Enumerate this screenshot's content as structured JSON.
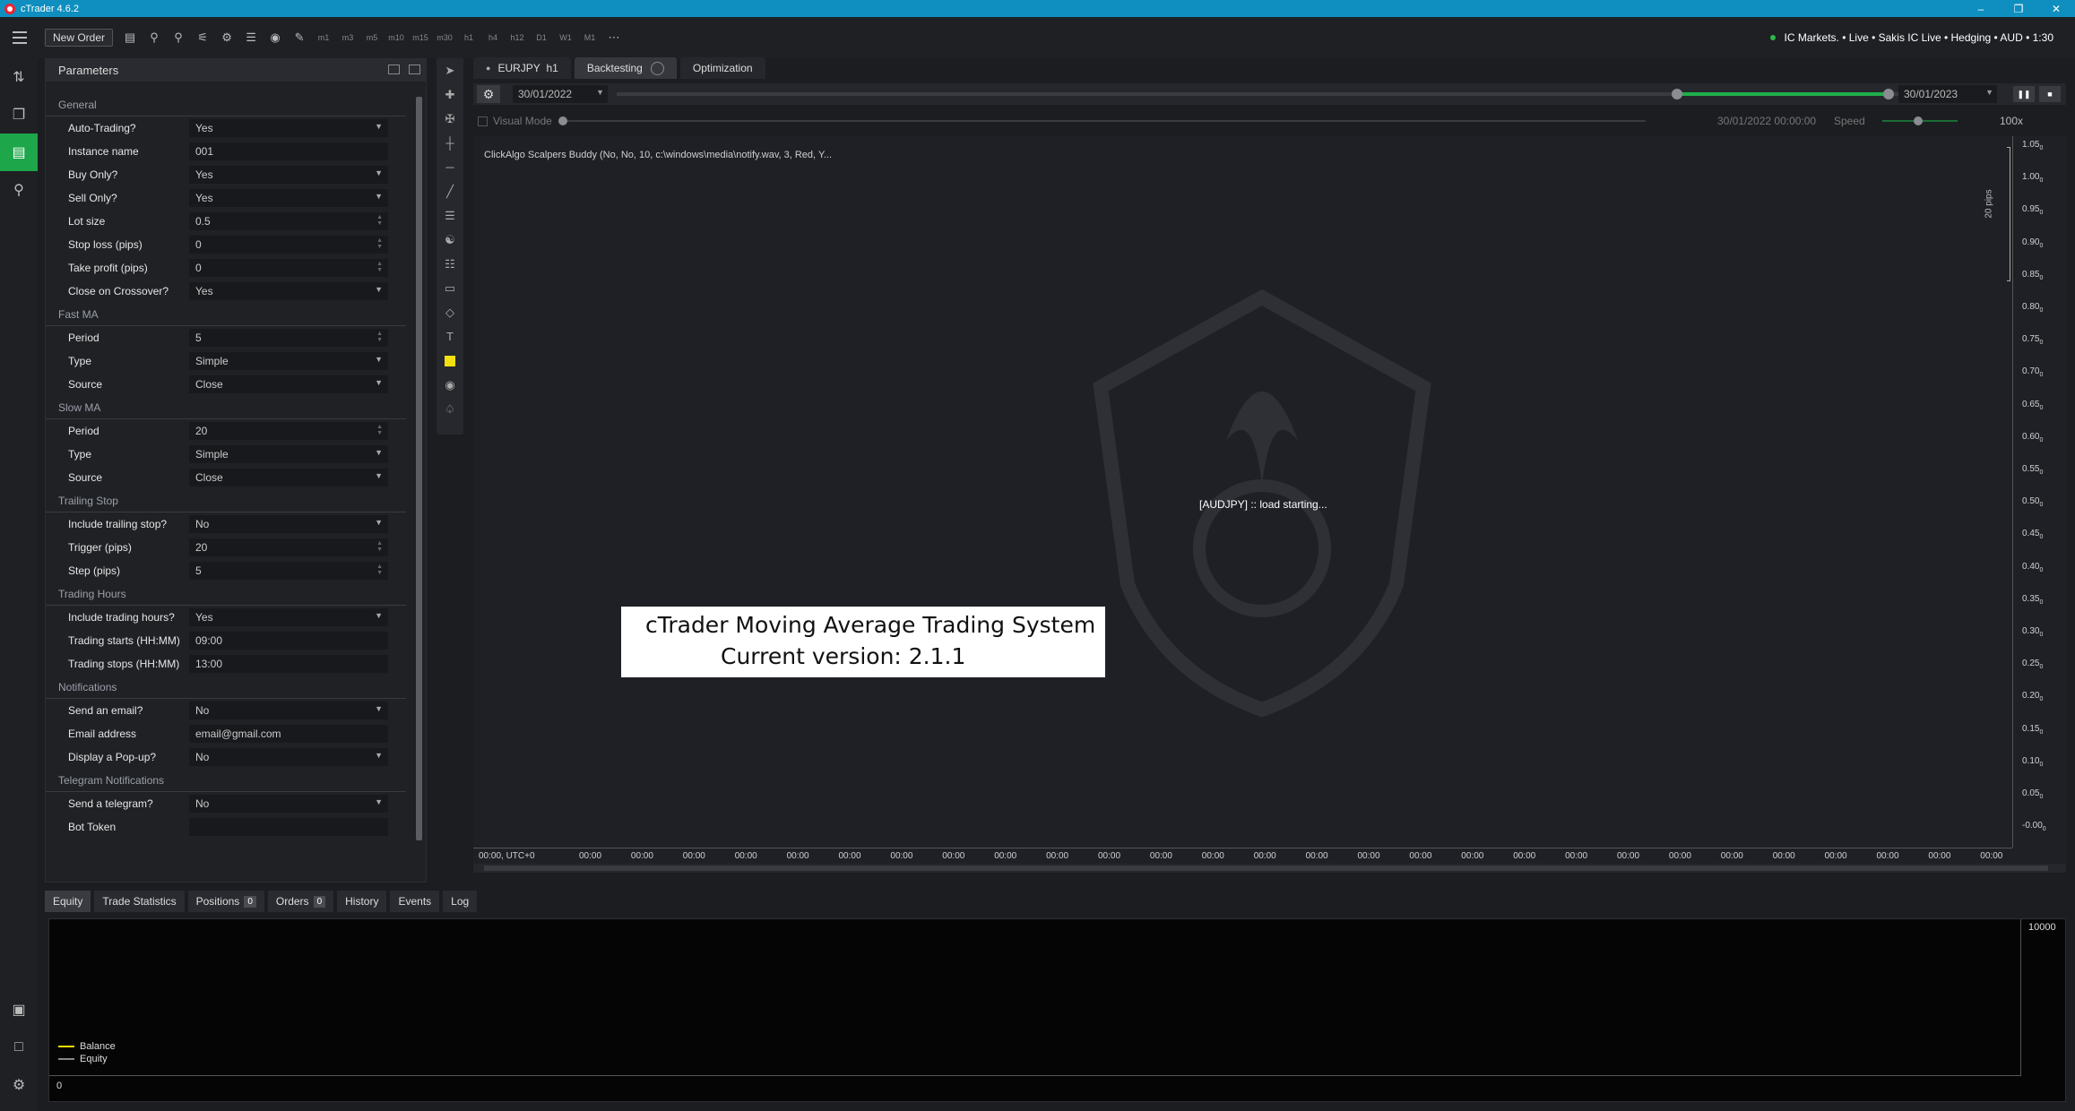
{
  "titlebar": {
    "title": "cTrader 4.6.2"
  },
  "toolbar": {
    "new_order": "New Order",
    "timeframes": [
      "m1",
      "m3",
      "m5",
      "m10",
      "m15",
      "m30",
      "h1",
      "h4",
      "h12",
      "D1",
      "W1",
      "M1"
    ],
    "account": "IC Markets. • Live • Sakis IC Live • Hedging • AUD • 1:30"
  },
  "params": {
    "title": "Parameters",
    "general": {
      "section": "General",
      "auto_trading": {
        "label": "Auto-Trading?",
        "value": "Yes"
      },
      "instance_name": {
        "label": "Instance name",
        "value": "001"
      },
      "buy_only": {
        "label": "Buy Only?",
        "value": "Yes"
      },
      "sell_only": {
        "label": "Sell Only?",
        "value": "Yes"
      },
      "lot_size": {
        "label": "Lot size",
        "value": "0.5"
      },
      "stop_loss": {
        "label": "Stop loss (pips)",
        "value": "0"
      },
      "take_profit": {
        "label": "Take profit (pips)",
        "value": "0"
      },
      "close_crossover": {
        "label": "Close on Crossover?",
        "value": "Yes"
      }
    },
    "fast_ma": {
      "section": "Fast MA",
      "period": {
        "label": "Period",
        "value": "5"
      },
      "type": {
        "label": "Type",
        "value": "Simple"
      },
      "source": {
        "label": "Source",
        "value": "Close"
      }
    },
    "slow_ma": {
      "section": "Slow MA",
      "period": {
        "label": "Period",
        "value": "20"
      },
      "type": {
        "label": "Type",
        "value": "Simple"
      },
      "source": {
        "label": "Source",
        "value": "Close"
      }
    },
    "trailing": {
      "section": "Trailing Stop",
      "include": {
        "label": "Include trailing stop?",
        "value": "No"
      },
      "trigger": {
        "label": "Trigger (pips)",
        "value": "20"
      },
      "step": {
        "label": "Step (pips)",
        "value": "5"
      }
    },
    "hours": {
      "section": "Trading Hours",
      "include": {
        "label": "Include trading hours?",
        "value": "Yes"
      },
      "starts": {
        "label": "Trading starts (HH:MM)",
        "value": "09:00"
      },
      "stops": {
        "label": "Trading stops (HH:MM)",
        "value": "13:00"
      }
    },
    "notifications": {
      "section": "Notifications",
      "email": {
        "label": "Send an email?",
        "value": "No"
      },
      "address": {
        "label": "Email address",
        "value": "email@gmail.com"
      },
      "popup": {
        "label": "Display a Pop-up?",
        "value": "No"
      }
    },
    "telegram": {
      "section": "Telegram Notifications",
      "send": {
        "label": "Send a telegram?",
        "value": "No"
      },
      "token": {
        "label": "Bot Token",
        "value": ""
      }
    }
  },
  "tabs": {
    "symbol": "EURJPY",
    "timeframe": "h1",
    "backtesting": "Backtesting",
    "optimization": "Optimization"
  },
  "backtest": {
    "start_date": "30/01/2022",
    "end_date": "30/01/2023",
    "progress_pct": 100,
    "visual_mode": "Visual Mode",
    "current_time": "30/01/2022 00:00:00",
    "speed_label": "Speed",
    "speed_value": "100x"
  },
  "chart": {
    "indicator_label": "ClickAlgo Scalpers Buddy (No, No, 10, c:\\windows\\media\\notify.wav, 3, Red, Y...",
    "status": "[AUDJPY] :: load starting...",
    "pips_label": "20 pips",
    "y_ticks": [
      "1.05",
      "1.00",
      "0.95",
      "0.90",
      "0.85",
      "0.80",
      "0.75",
      "0.70",
      "0.65",
      "0.60",
      "0.55",
      "0.50",
      "0.45",
      "0.40",
      "0.35",
      "0.30",
      "0.25",
      "0.20",
      "0.15",
      "0.10",
      "0.05",
      "-0.00"
    ],
    "y_subscript": "0",
    "x_first": "00:00, UTC+0",
    "x_tick": "00:00",
    "x_tick_count": 28
  },
  "banner": {
    "line1": "cTrader Moving Average Trading System",
    "line2": "Current version: 2.1.1"
  },
  "bottom": {
    "tabs": {
      "equity": "Equity",
      "trade_stats": "Trade Statistics",
      "positions": "Positions",
      "orders": "Orders",
      "history": "History",
      "events": "Events",
      "log": "Log"
    },
    "positions_count": "0",
    "orders_count": "0",
    "y_max": "10000",
    "y_min": "0",
    "legend_balance": "Balance",
    "legend_equity": "Equity",
    "balance_color": "#f0e000",
    "equity_color": "#888888"
  },
  "colors": {
    "accent": "#1da64a",
    "titlebar": "#0e8fbf"
  }
}
